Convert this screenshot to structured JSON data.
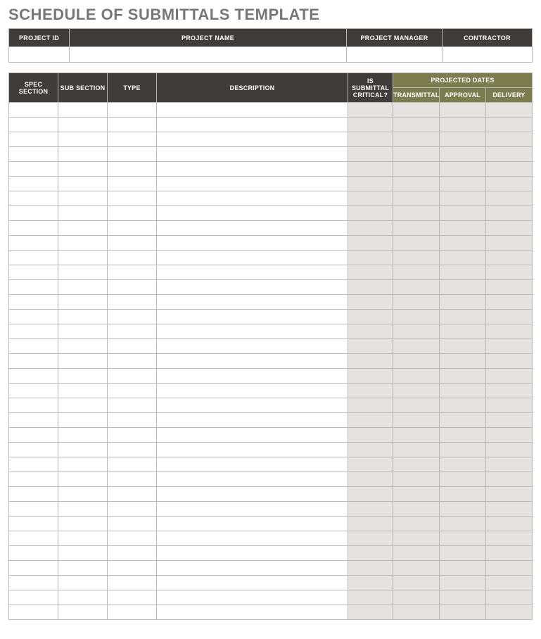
{
  "title": "SCHEDULE OF SUBMITTALS TEMPLATE",
  "project_header": {
    "project_id": "PROJECT ID",
    "project_name": "PROJECT NAME",
    "project_manager": "PROJECT MANAGER",
    "contractor": "CONTRACTOR"
  },
  "project_values": {
    "project_id": "",
    "project_name": "",
    "project_manager": "",
    "contractor": ""
  },
  "columns": {
    "spec_section": "SPEC SECTION",
    "sub_section": "SUB SECTION",
    "type": "TYPE",
    "description": "DESCRIPTION",
    "is_critical": "IS SUBMITTAL CRITICAL?",
    "projected_dates": "PROJECTED DATES",
    "transmittal": "TRANSMITTAL",
    "approval": "APPROVAL",
    "delivery": "DELIVERY"
  },
  "row_count": 35,
  "rows": []
}
